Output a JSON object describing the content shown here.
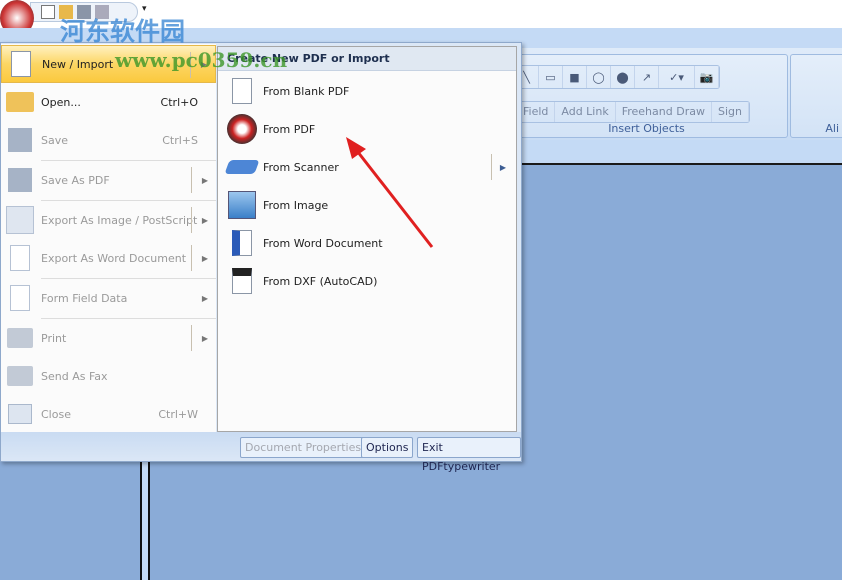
{
  "watermark": {
    "line1": "河东软件园",
    "line2": "www.pc0359.cn"
  },
  "ribbon": {
    "insert_group_label": "Insert Objects",
    "align_group_label": "Ali",
    "buttons": [
      "Field",
      "Add Link",
      "Freehand Draw",
      "Sign"
    ]
  },
  "menu": {
    "items": [
      {
        "label": "New / Import",
        "shortcut": "",
        "icon": "blank-page-icon"
      },
      {
        "label": "Open...",
        "shortcut": "Ctrl+O",
        "icon": "folder-open-icon"
      },
      {
        "label": "Save",
        "shortcut": "Ctrl+S",
        "icon": "floppy-icon"
      },
      {
        "label": "Save As PDF",
        "shortcut": "",
        "icon": "floppy-pencil-icon"
      },
      {
        "label": "Export As Image / PostScript",
        "shortcut": "",
        "icon": "image-icon"
      },
      {
        "label": "Export As Word Document",
        "shortcut": "",
        "icon": "word-doc-icon"
      },
      {
        "label": "Form Field Data",
        "shortcut": "",
        "icon": "xml-doc-icon"
      },
      {
        "label": "Print",
        "shortcut": "",
        "icon": "printer-icon"
      },
      {
        "label": "Send As Fax",
        "shortcut": "",
        "icon": "fax-icon"
      },
      {
        "label": "Close",
        "shortcut": "Ctrl+W",
        "icon": "folder-close-icon"
      }
    ],
    "submenu": {
      "title": "Create New PDF or Import",
      "items": [
        {
          "label": "From Blank PDF",
          "icon": "blank-page-icon"
        },
        {
          "label": "From PDF",
          "icon": "pdf-icon"
        },
        {
          "label": "From Scanner",
          "icon": "scanner-icon"
        },
        {
          "label": "From Image",
          "icon": "image-icon"
        },
        {
          "label": "From Word Document",
          "icon": "word-doc-icon"
        },
        {
          "label": "From DXF (AutoCAD)",
          "icon": "dxf-icon"
        }
      ]
    },
    "buttons": {
      "doc_props": "Document Properties",
      "options": "Options",
      "exit": "Exit PDFtypewriter"
    }
  },
  "colors": {
    "highlight": "#fbc93e",
    "arrow": "#e02020",
    "workspace": "#8aabd7"
  }
}
